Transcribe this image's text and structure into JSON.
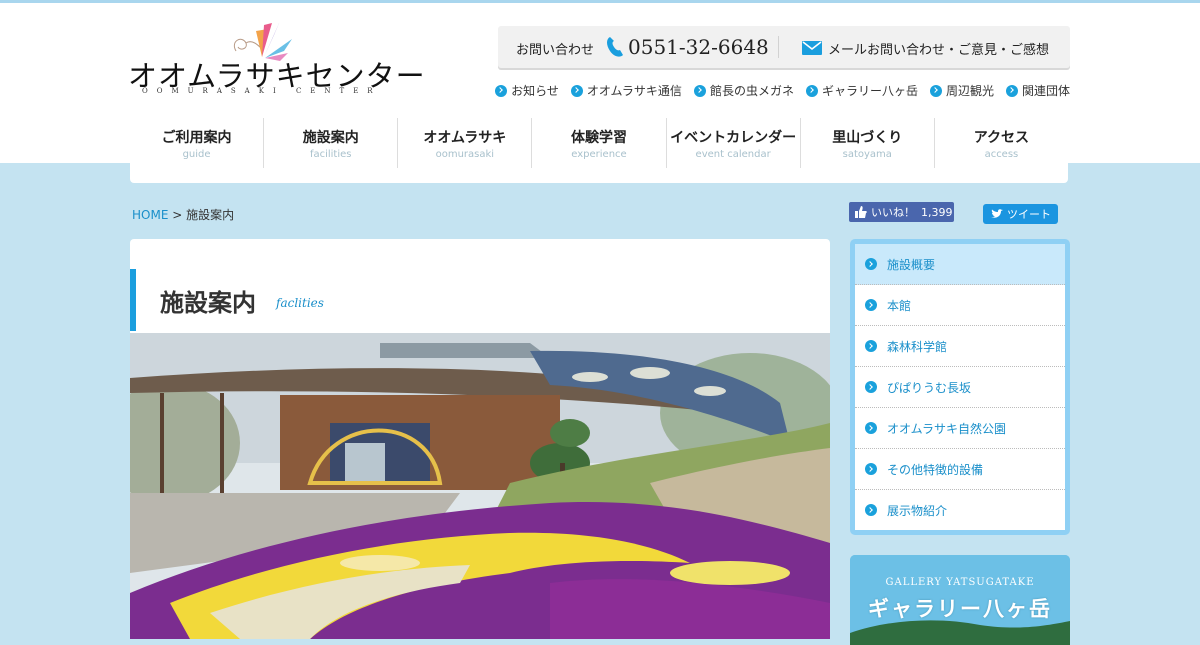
{
  "site": {
    "logo_text": "オオムラサキセンター",
    "logo_sub": "OOMURASAKI CENTER"
  },
  "contact": {
    "label": "お問い合わせ",
    "phone": "0551-32-6648",
    "mail_label": "メールお問い合わせ・ご意見・ご感想"
  },
  "subnav": [
    {
      "label": "お知らせ"
    },
    {
      "label": "オオムラサキ通信"
    },
    {
      "label": "館長の虫メガネ"
    },
    {
      "label": "ギャラリー八ヶ岳"
    },
    {
      "label": "周辺観光"
    },
    {
      "label": "関連団体"
    }
  ],
  "mainnav": [
    {
      "jp": "ご利用案内",
      "en": "guide"
    },
    {
      "jp": "施設案内",
      "en": "facilities"
    },
    {
      "jp": "オオムラサキ",
      "en": "oomurasaki"
    },
    {
      "jp": "体験学習",
      "en": "experience"
    },
    {
      "jp": "イベントカレンダー",
      "en": "event calendar"
    },
    {
      "jp": "里山づくり",
      "en": "satoyama"
    },
    {
      "jp": "アクセス",
      "en": "access"
    }
  ],
  "breadcrumb": {
    "home": "HOME",
    "separator": ">",
    "current": "施設案内"
  },
  "social": {
    "like_label": "いいね！",
    "like_count": "1,399",
    "tweet_label": "ツイート"
  },
  "page": {
    "title": "施設案内",
    "title_en": "faclities"
  },
  "sidemenu": [
    {
      "label": "施設概要",
      "active": true
    },
    {
      "label": "本館"
    },
    {
      "label": "森林科学館"
    },
    {
      "label": "ぴぱりうむ長坂"
    },
    {
      "label": "オオムラサキ自然公園"
    },
    {
      "label": "その他特徴的設備"
    },
    {
      "label": "展示物紹介"
    }
  ],
  "banner": {
    "en": "GALLERY YATSUGATAKE",
    "jp": "ギャラリー八ヶ岳"
  },
  "colors": {
    "accent": "#1a9ede",
    "link": "#1a8fca",
    "background": "#c4e3f1",
    "side_border": "#8fd0f4",
    "fb": "#4a66ad",
    "twitter": "#1b95e0"
  }
}
